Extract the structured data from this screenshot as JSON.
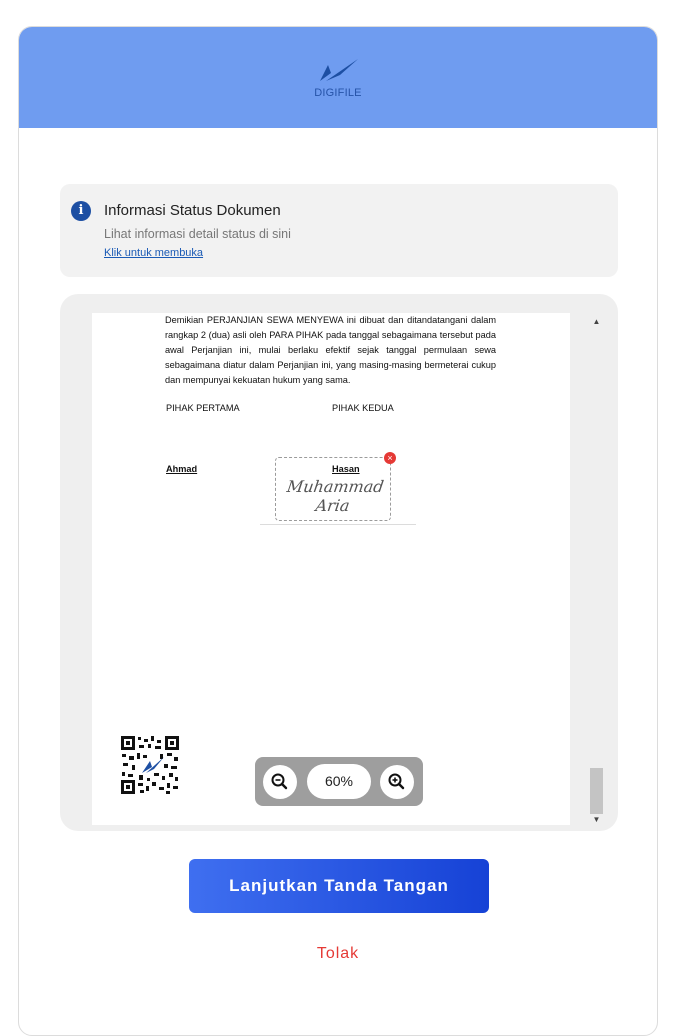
{
  "brand": {
    "name": "DIGIFILE",
    "color": "#6f9cf0"
  },
  "info": {
    "icon": "info-icon",
    "title": "Informasi Status Dokumen",
    "subtitle": "Lihat informasi detail status di sini",
    "link": "Klik untuk membuka"
  },
  "document": {
    "paragraph": "Demikian PERJANJIAN SEWA MENYEWA ini dibuat dan ditandatangani dalam rangkap 2 (dua) asli oleh PARA PIHAK pada tanggal sebagaimana tersebut pada awal Perjanjian ini, mulai berlaku efektif sejak tanggal permulaan sewa sebagaimana diatur dalam Perjanjian ini, yang masing-masing bermeterai cukup dan mempunyai kekuatan hukum yang sama.",
    "party_first_label": "PIHAK PERTAMA",
    "party_second_label": "PIHAK KEDUA",
    "party_first_name": "Ahmad",
    "party_second_name": "Hasan",
    "signature": "Muhammad Aria"
  },
  "zoom": {
    "value": "60%",
    "out_icon": "zoom-out-icon",
    "in_icon": "zoom-in-icon"
  },
  "actions": {
    "continue": "Lanjutkan Tanda Tangan",
    "reject": "Tolak"
  },
  "colors": {
    "primary": "#1642d6",
    "danger": "#e53935",
    "link": "#1a5ab5"
  }
}
